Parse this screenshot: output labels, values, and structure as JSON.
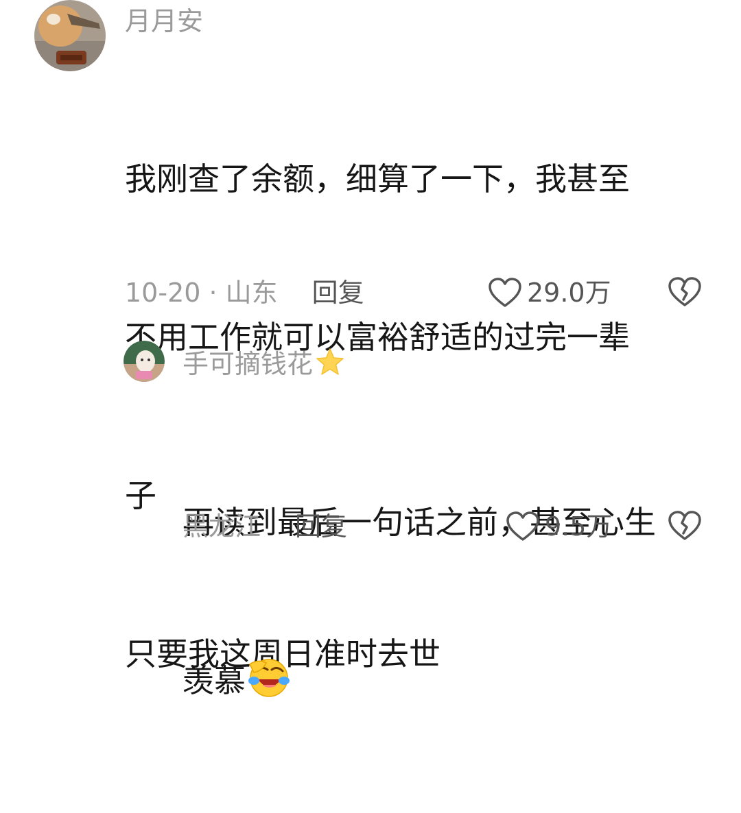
{
  "comments": [
    {
      "username": "月月安",
      "lines": [
        "我刚查了余额，细算了一下，我甚至",
        "不用工作就可以富裕舒适的过完一辈",
        "子",
        "只要我这周日准时去世"
      ],
      "date_location": "10-20 · 山东",
      "reply_label": "回复",
      "likes": "29.0万",
      "avatar_icon": "cat-avatar",
      "like_icon": "heart-outline-icon",
      "dislike_icon": "broken-heart-icon"
    },
    {
      "username": "手可摘钱花",
      "username_badge_icon": "star-emoji-icon",
      "lines": [
        "再读到最后一句话之前，甚至心生",
        "羡慕"
      ],
      "trailing_emoji_icon": "laughing-crying-emoji-icon",
      "location": "黑龙江",
      "reply_label": "回复",
      "likes": "9.5万",
      "avatar_icon": "figurine-avatar",
      "like_icon": "heart-outline-icon",
      "dislike_icon": "broken-heart-icon"
    }
  ],
  "colors": {
    "meta_text": "#9a9a9a",
    "primary_text": "#161616",
    "action_text": "#555555"
  }
}
